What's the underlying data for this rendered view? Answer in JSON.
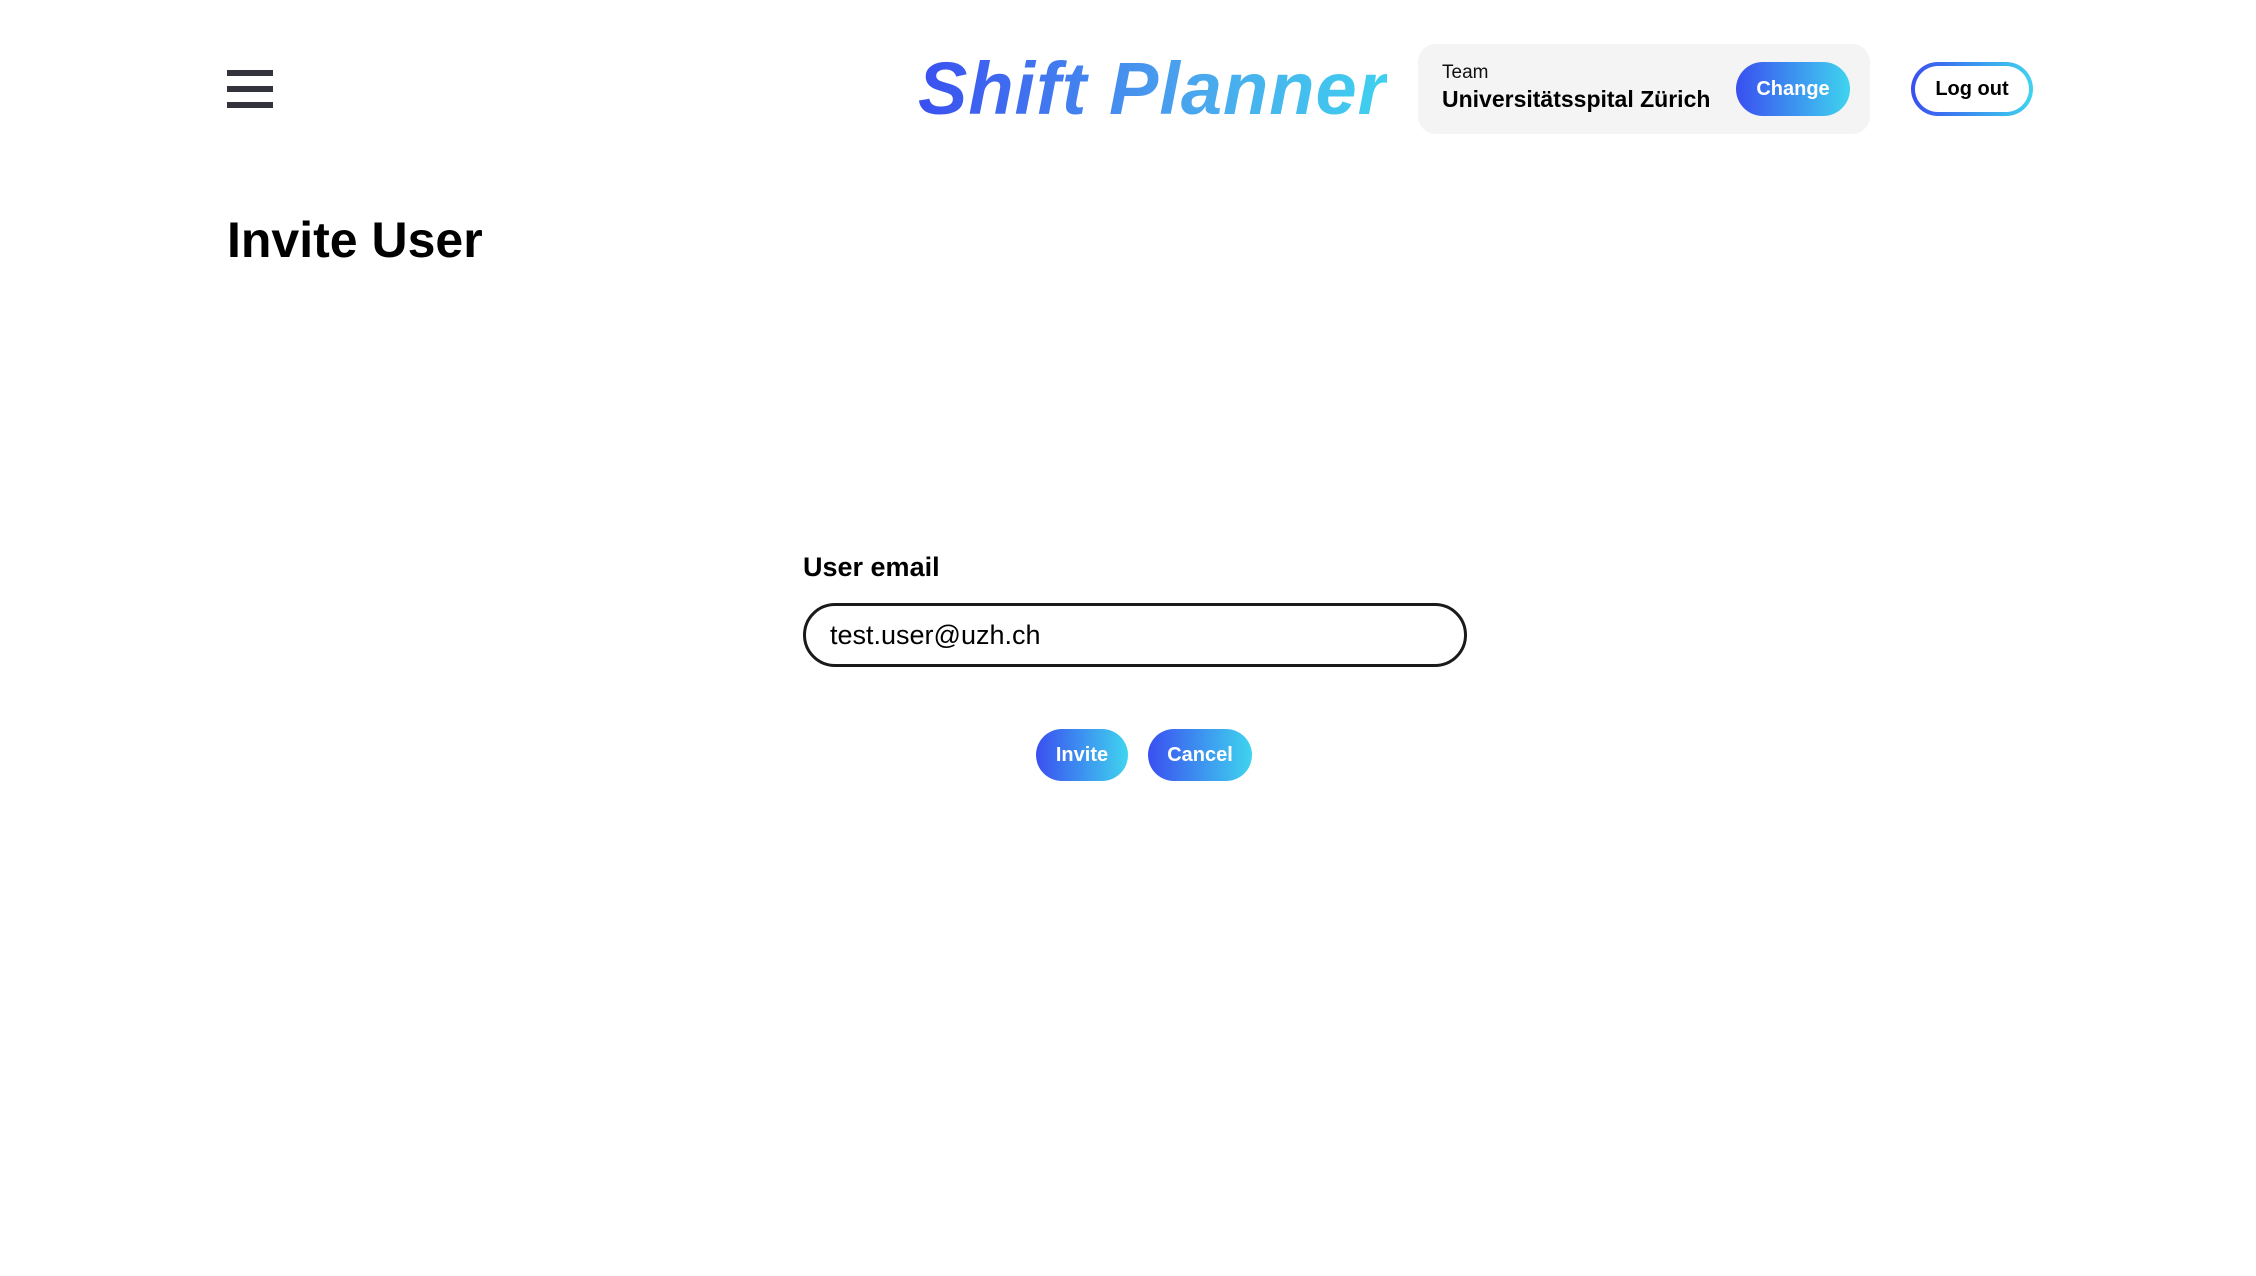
{
  "header": {
    "menu_icon": "hamburger-menu-icon",
    "app_title": "Shift Planner",
    "team": {
      "caption": "Team",
      "name": "Universitätsspital Zürich",
      "change_label": "Change"
    },
    "logout_label": "Log out"
  },
  "page": {
    "title": "Invite User"
  },
  "form": {
    "email_label": "User email",
    "email_value": "test.user@uzh.ch",
    "invite_label": "Invite",
    "cancel_label": "Cancel"
  },
  "colors": {
    "gradient_start": "#3a4ff0",
    "gradient_end": "#3fd4ef",
    "menu_icon": "#33333d",
    "team_box_bg": "#f4f4f4"
  }
}
